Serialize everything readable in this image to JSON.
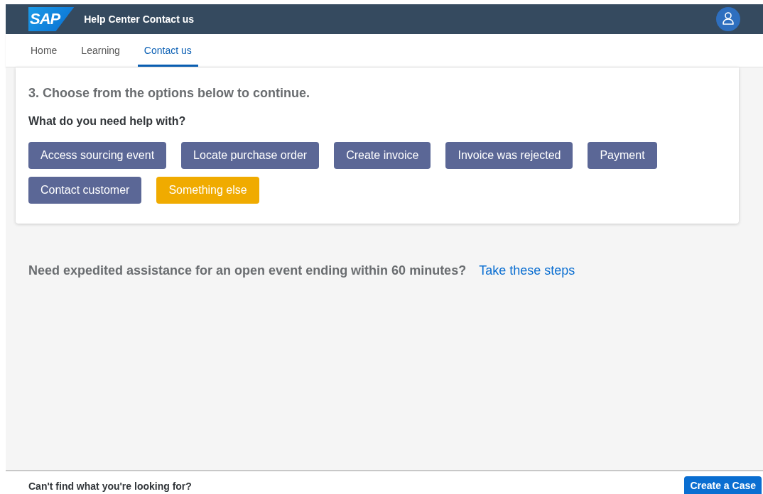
{
  "header": {
    "logo": "SAP",
    "title": "Help Center Contact us"
  },
  "tabs": [
    {
      "label": "Home",
      "selected": false
    },
    {
      "label": "Learning",
      "selected": false
    },
    {
      "label": "Contact us",
      "selected": true
    }
  ],
  "card": {
    "step": "3. Choose from the options below to continue.",
    "question": "What do you need help with?",
    "options": [
      {
        "label": "Access sourcing event",
        "selected": false
      },
      {
        "label": "Locate purchase order",
        "selected": false
      },
      {
        "label": "Create invoice",
        "selected": false
      },
      {
        "label": "Invoice was rejected",
        "selected": false
      },
      {
        "label": "Payment",
        "selected": false
      },
      {
        "label": "Contact customer",
        "selected": false
      },
      {
        "label": "Something else",
        "selected": true
      }
    ]
  },
  "expedite": {
    "text": "Need expedited assistance for an open event ending within 60 minutes?",
    "link": "Take these steps"
  },
  "footer": {
    "text": "Can't find what you're looking for?",
    "button": "Create a Case"
  }
}
